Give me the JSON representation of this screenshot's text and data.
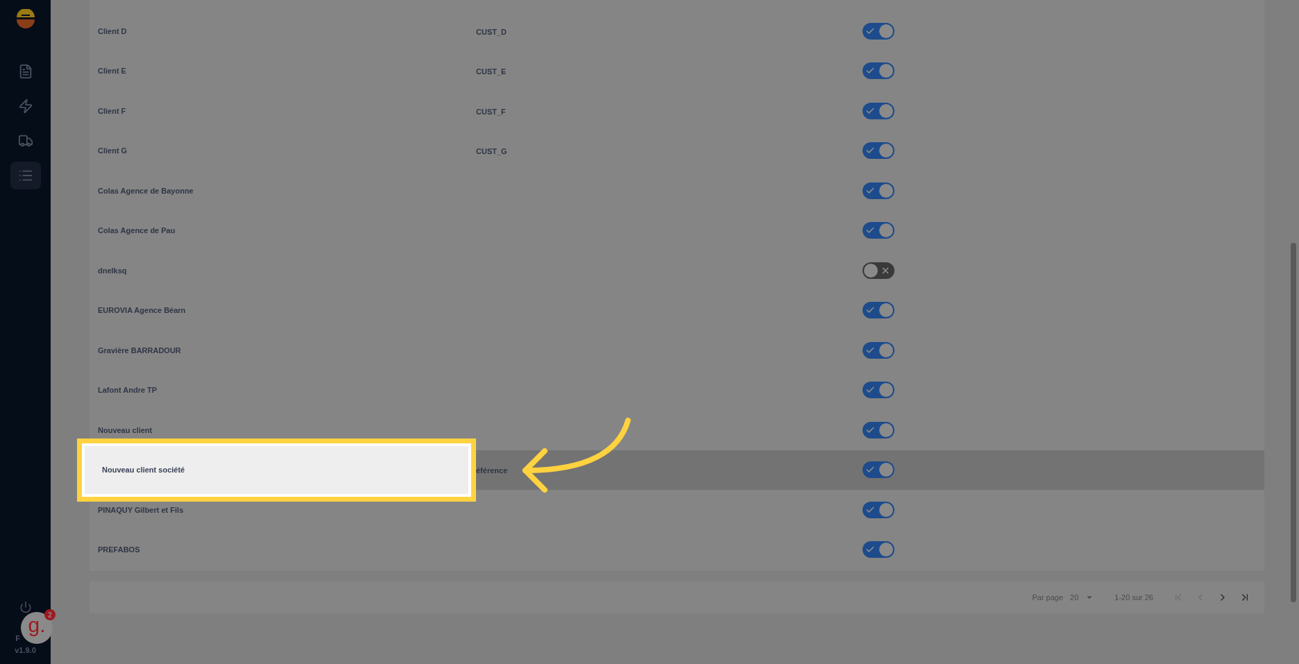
{
  "sidebar": {
    "items": [
      {
        "kind": "document",
        "selected": false
      },
      {
        "kind": "bolt",
        "selected": false
      },
      {
        "kind": "loader",
        "selected": false
      },
      {
        "kind": "list",
        "selected": true
      }
    ],
    "language": "F",
    "version": "v1.9.0",
    "badge": {
      "letter": "g.",
      "count": "2"
    }
  },
  "table": {
    "rows": [
      {
        "name": "Client D",
        "code": "CUST_D",
        "active": true,
        "highlighted": false
      },
      {
        "name": "Client E",
        "code": "CUST_E",
        "active": true,
        "highlighted": false
      },
      {
        "name": "Client F",
        "code": "CUST_F",
        "active": true,
        "highlighted": false
      },
      {
        "name": "Client G",
        "code": "CUST_G",
        "active": true,
        "highlighted": false
      },
      {
        "name": "Colas Agence de Bayonne",
        "active": true,
        "highlighted": false
      },
      {
        "name": "Colas Agence de Pau",
        "active": true,
        "highlighted": false
      },
      {
        "name": "dnelksq",
        "active": false,
        "highlighted": false
      },
      {
        "name": "EUROVIA Agence Béarn",
        "active": true,
        "highlighted": false
      },
      {
        "name": "Gravière BARRADOUR",
        "active": true,
        "highlighted": false
      },
      {
        "name": "Lafont Andre TP",
        "active": true,
        "highlighted": false
      },
      {
        "name": "Nouveau client",
        "active": true,
        "highlighted": false
      },
      {
        "name": "Nouveau client société",
        "code": "éférence",
        "active": true,
        "highlighted": true
      },
      {
        "name": "PINAQUY Gilbert et Fils",
        "active": true,
        "highlighted": false
      },
      {
        "name": "PREFABOS",
        "active": true,
        "highlighted": false
      }
    ]
  },
  "pagination": {
    "per_page_label": "Par page",
    "per_page": "20",
    "range": "1-20 sur 26"
  }
}
